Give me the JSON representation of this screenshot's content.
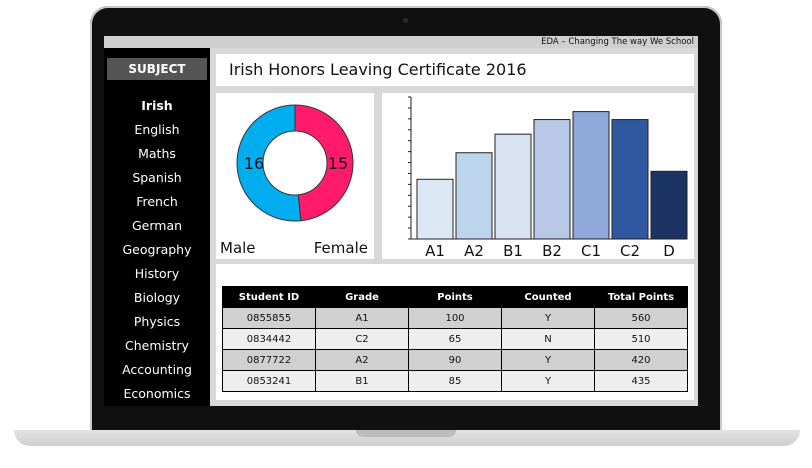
{
  "screen_header": "EDA – Changing The way We School",
  "sidebar": {
    "header": "SUBJECT",
    "items": [
      {
        "label": "Irish",
        "active": true
      },
      {
        "label": "English"
      },
      {
        "label": "Maths"
      },
      {
        "label": "Spanish"
      },
      {
        "label": "French"
      },
      {
        "label": "German"
      },
      {
        "label": "Geography"
      },
      {
        "label": "History"
      },
      {
        "label": "Biology"
      },
      {
        "label": "Physics"
      },
      {
        "label": "Chemistry"
      },
      {
        "label": "Accounting"
      },
      {
        "label": "Economics"
      }
    ]
  },
  "main": {
    "title": "Irish Honors Leaving Certificate 2016"
  },
  "gender_chart": {
    "male_label": "Male",
    "female_label": "Female",
    "male_value": "16",
    "female_value": "15"
  },
  "chart_data": [
    {
      "type": "pie",
      "variant": "donut",
      "categories": [
        "Male",
        "Female"
      ],
      "values": [
        16,
        15
      ],
      "colors": [
        "#00aeef",
        "#ff1a6c"
      ]
    },
    {
      "type": "bar",
      "categories": [
        "A1",
        "A2",
        "B1",
        "B2",
        "C1",
        "C2",
        "D"
      ],
      "values": [
        4.5,
        6.5,
        7.9,
        9.0,
        9.6,
        9.0,
        5.1
      ],
      "colors": [
        "#dde8f5",
        "#bcd4ec",
        "#d9e2f2",
        "#b8c8e6",
        "#8fa8da",
        "#2f58a0",
        "#1c3464"
      ],
      "ylim": [
        0,
        10.7
      ],
      "grid": false,
      "yticks_labeled": false
    }
  ],
  "table": {
    "columns": [
      "Student ID",
      "Grade",
      "Points",
      "Counted",
      "Total Points"
    ],
    "rows": [
      [
        "0855855",
        "A1",
        "100",
        "Y",
        "560"
      ],
      [
        "0834442",
        "C2",
        "65",
        "N",
        "510"
      ],
      [
        "0877722",
        "A2",
        "90",
        "Y",
        "420"
      ],
      [
        "0853241",
        "B1",
        "85",
        "Y",
        "435"
      ]
    ]
  }
}
